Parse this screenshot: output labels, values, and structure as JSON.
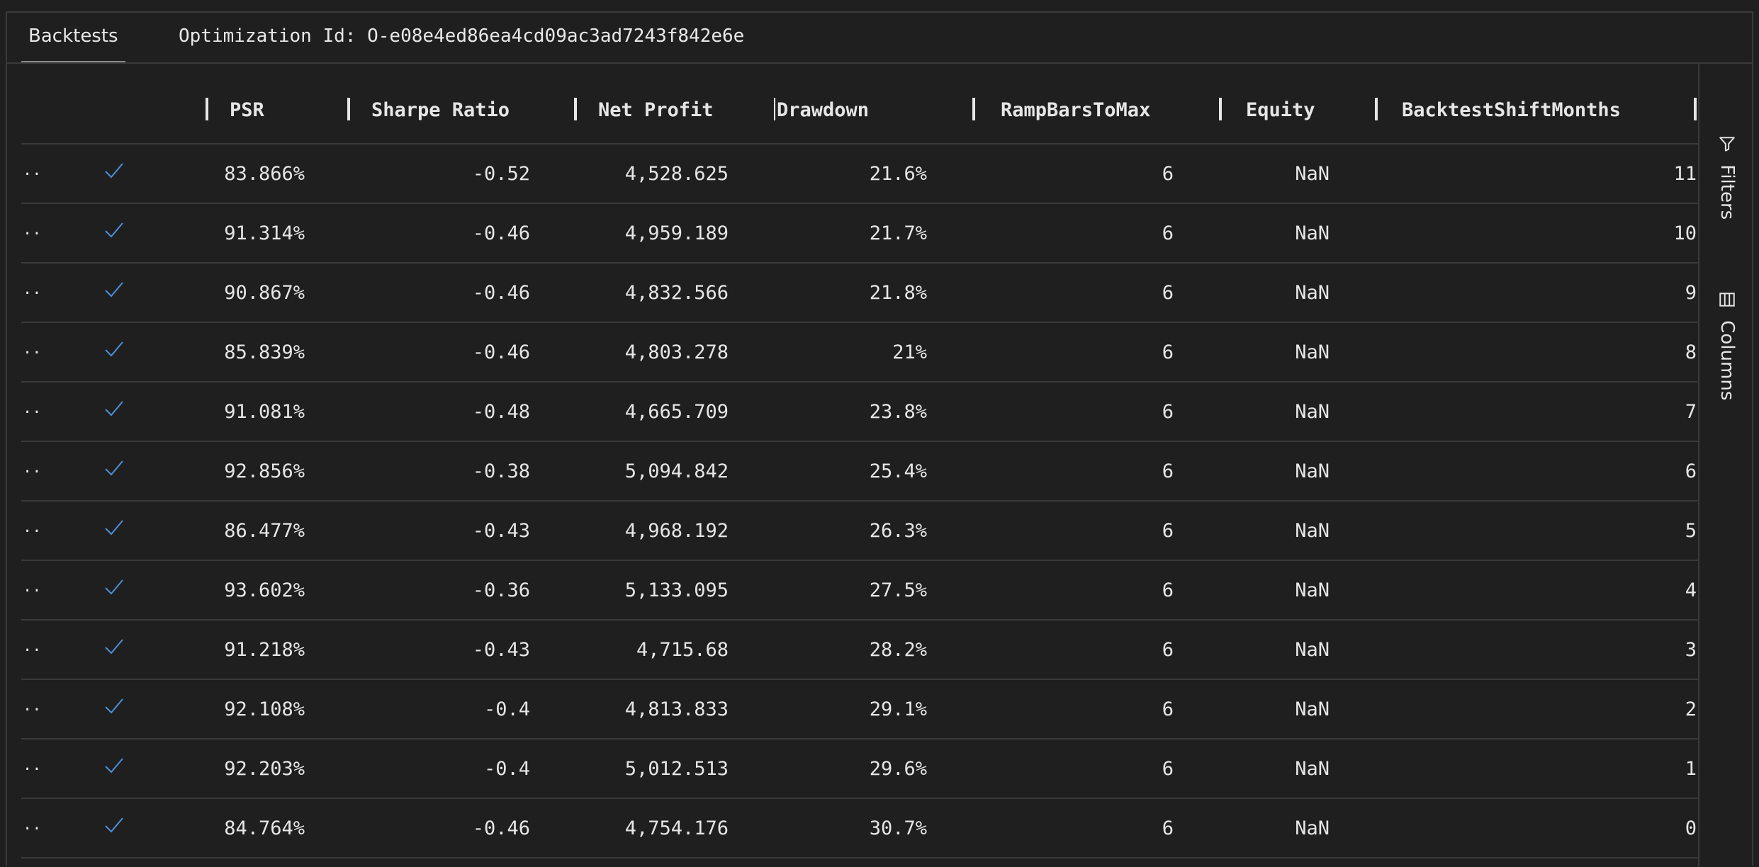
{
  "tabs": {
    "backtests_label": "Backtests",
    "optimization_label": "Optimization Id: O-e08e4ed86ea4cd09ac3ad7243f842e6e"
  },
  "columns": [
    "PSR",
    "Sharpe Ratio",
    "Net Profit",
    "Drawdown",
    "RampBarsToMax",
    "Equity",
    "BacktestShiftMonths"
  ],
  "rows": [
    {
      "psr": "83.866%",
      "sharpe": "-0.52",
      "net_profit": "4,528.625",
      "drawdown": "21.6%",
      "ramp": "6",
      "equity": "NaN",
      "shift": "11"
    },
    {
      "psr": "91.314%",
      "sharpe": "-0.46",
      "net_profit": "4,959.189",
      "drawdown": "21.7%",
      "ramp": "6",
      "equity": "NaN",
      "shift": "10"
    },
    {
      "psr": "90.867%",
      "sharpe": "-0.46",
      "net_profit": "4,832.566",
      "drawdown": "21.8%",
      "ramp": "6",
      "equity": "NaN",
      "shift": "9"
    },
    {
      "psr": "85.839%",
      "sharpe": "-0.46",
      "net_profit": "4,803.278",
      "drawdown": "21%",
      "ramp": "6",
      "equity": "NaN",
      "shift": "8"
    },
    {
      "psr": "91.081%",
      "sharpe": "-0.48",
      "net_profit": "4,665.709",
      "drawdown": "23.8%",
      "ramp": "6",
      "equity": "NaN",
      "shift": "7"
    },
    {
      "psr": "92.856%",
      "sharpe": "-0.38",
      "net_profit": "5,094.842",
      "drawdown": "25.4%",
      "ramp": "6",
      "equity": "NaN",
      "shift": "6"
    },
    {
      "psr": "86.477%",
      "sharpe": "-0.43",
      "net_profit": "4,968.192",
      "drawdown": "26.3%",
      "ramp": "6",
      "equity": "NaN",
      "shift": "5"
    },
    {
      "psr": "93.602%",
      "sharpe": "-0.36",
      "net_profit": "5,133.095",
      "drawdown": "27.5%",
      "ramp": "6",
      "equity": "NaN",
      "shift": "4"
    },
    {
      "psr": "91.218%",
      "sharpe": "-0.43",
      "net_profit": "4,715.68",
      "drawdown": "28.2%",
      "ramp": "6",
      "equity": "NaN",
      "shift": "3"
    },
    {
      "psr": "92.108%",
      "sharpe": "-0.4",
      "net_profit": "4,813.833",
      "drawdown": "29.1%",
      "ramp": "6",
      "equity": "NaN",
      "shift": "2"
    },
    {
      "psr": "92.203%",
      "sharpe": "-0.4",
      "net_profit": "5,012.513",
      "drawdown": "29.6%",
      "ramp": "6",
      "equity": "NaN",
      "shift": "1"
    },
    {
      "psr": "84.764%",
      "sharpe": "-0.46",
      "net_profit": "4,754.176",
      "drawdown": "30.7%",
      "ramp": "6",
      "equity": "NaN",
      "shift": "0"
    }
  ],
  "row_marker": "..",
  "status_icon": "check-icon",
  "sidebar": {
    "filters_label": "Filters",
    "columns_label": "Columns"
  },
  "colors": {
    "check": "#4e8fd6",
    "background": "#1f1f1f",
    "border": "#3a3a3a"
  }
}
